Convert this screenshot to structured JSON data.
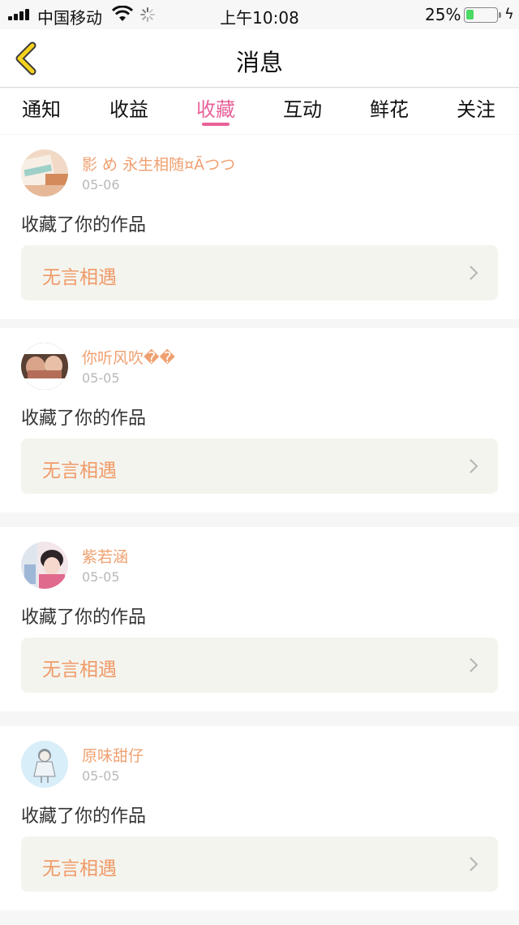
{
  "status_bar": {
    "carrier": "中国移动",
    "time": "上午10:08",
    "battery_percent": "25%",
    "battery_level": 0.25
  },
  "header": {
    "title": "消息",
    "back_icon": "chevron-left-icon"
  },
  "tabs": [
    {
      "label": "通知",
      "active": false
    },
    {
      "label": "收益",
      "active": false
    },
    {
      "label": "收藏",
      "active": true
    },
    {
      "label": "互动",
      "active": false
    },
    {
      "label": "鲜花",
      "active": false
    },
    {
      "label": "关注",
      "active": false
    }
  ],
  "notifications": [
    {
      "username": "影 め 永生相随¤Ãつつ",
      "date": "05-06",
      "action": "收藏了你的作品",
      "work_title": "无言相遇"
    },
    {
      "username": "你听风吹��",
      "date": "05-05",
      "action": "收藏了你的作品",
      "work_title": "无言相遇"
    },
    {
      "username": "紫若涵",
      "date": "05-05",
      "action": "收藏了你的作品",
      "work_title": "无言相遇"
    },
    {
      "username": "原味甜仔",
      "date": "05-05",
      "action": "收藏了你的作品",
      "work_title": "无言相遇"
    }
  ],
  "colors": {
    "accent_pink": "#e8629a",
    "username_orange": "#f0a070",
    "work_title_orange": "#f09a68",
    "back_icon_yellow": "#f5d21c",
    "battery_green": "#4cd964"
  }
}
